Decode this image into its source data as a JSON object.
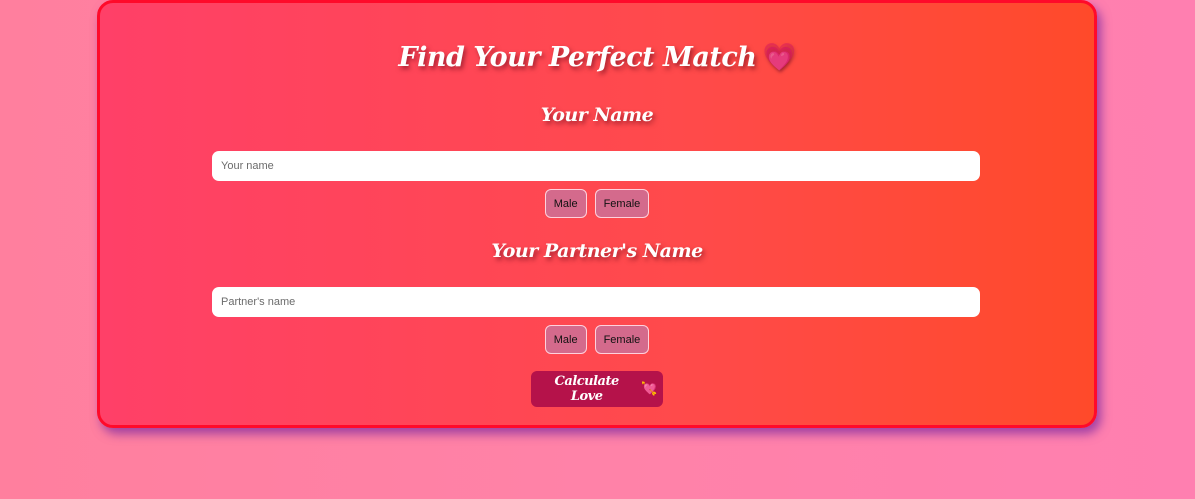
{
  "title": {
    "text": "Find Your Perfect Match",
    "icon": "heart-icon",
    "icon_glyph": "💗"
  },
  "your_section": {
    "heading": "Your Name",
    "input_placeholder": "Your name",
    "input_value": "",
    "male_label": "Male",
    "female_label": "Female"
  },
  "partner_section": {
    "heading": "Your Partner's Name",
    "input_placeholder": "Partner's name",
    "input_value": "",
    "male_label": "Male",
    "female_label": "Female"
  },
  "calculate_button": {
    "label": "Calculate Love",
    "icon": "heart-arrow-icon",
    "icon_glyph": "💘"
  },
  "colors": {
    "card_border": "#ff0a2a",
    "button_bg": "#b5124a",
    "gender_button_bg": "#d46a8c"
  }
}
